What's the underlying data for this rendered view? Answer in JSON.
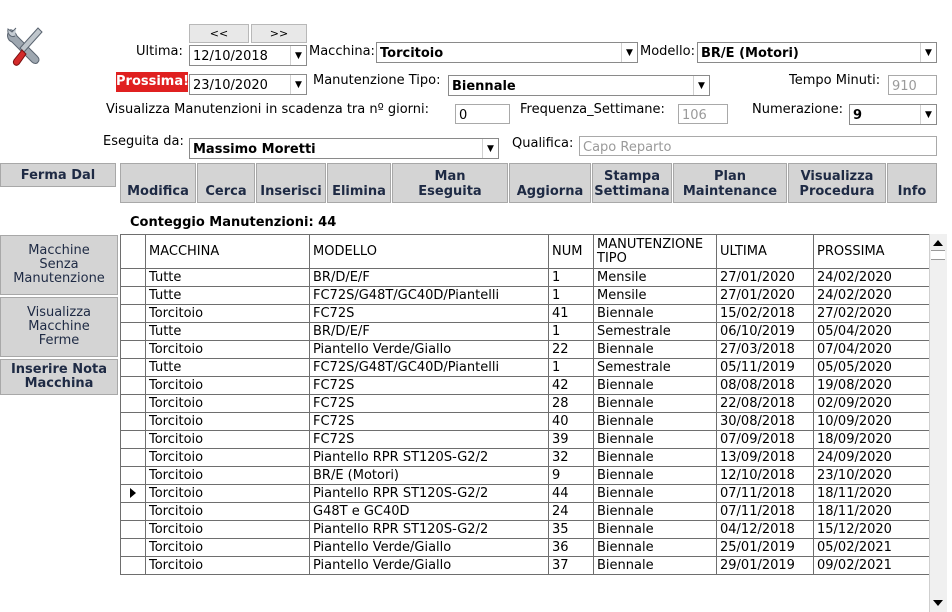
{
  "nav": {
    "prev": "<<",
    "next": ">>"
  },
  "form": {
    "ultima_label": "Ultima:",
    "ultima_value": "12/10/2018",
    "macchina_label": "Macchina:",
    "macchina_value": "Torcitoio",
    "modello_label": "Modello:",
    "modello_value": "BR/E (Motori)",
    "prossima_label": "Prossima!!",
    "prossima_value": "23/10/2020",
    "tipo_label": "Manutenzione Tipo:",
    "tipo_value": "Biennale",
    "tempo_label": "Tempo Minuti:",
    "tempo_value": "910",
    "scadenza_label": "Visualizza Manutenzioni in scadenza tra nº giorni:",
    "scadenza_value": "0",
    "frequenza_label": "Frequenza_Settimane:",
    "frequenza_value": "106",
    "numerazione_label": "Numerazione:",
    "numerazione_value": "9",
    "eseguita_label": "Eseguita da:",
    "eseguita_value": "Massimo Moretti",
    "qualifica_label": "Qualifica:",
    "qualifica_value": "Capo Reparto"
  },
  "toolbar": {
    "ferma_dal": "Ferma Dal",
    "modifica": "Modifica",
    "cerca": "Cerca",
    "inserisci": "Inserisci",
    "elimina": "Elimina",
    "man_eseguita_1": "Man",
    "man_eseguita_2": "Eseguita",
    "aggiorna": "Aggiorna",
    "stampa_1": "Stampa",
    "stampa_2": "Settimana",
    "plan_1": "Plan",
    "plan_2": "Maintenance",
    "visualizza_1": "Visualizza",
    "visualizza_2": "Procedura",
    "info": "Info"
  },
  "sidebar": {
    "senza_1": "Macchine",
    "senza_2": "Senza",
    "senza_3": "Manutenzione",
    "ferme_1": "Visualizza",
    "ferme_2": "Macchine",
    "ferme_3": "Ferme",
    "nota_1": "Inserire Nota",
    "nota_2": "Macchina"
  },
  "count_label": "Conteggio Manutenzioni: 44",
  "table": {
    "headers": [
      "MACCHINA",
      "MODELLO",
      "NUM",
      "MANUTENZIONE TIPO",
      "ULTIMA",
      "PROSSIMA"
    ],
    "selected_row": 12,
    "rows": [
      [
        "Tutte",
        "BR/D/E/F",
        "1",
        "Mensile",
        "27/01/2020",
        "24/02/2020"
      ],
      [
        "Tutte",
        "FC72S/G48T/GC40D/Piantelli",
        "1",
        "Mensile",
        "27/01/2020",
        "24/02/2020"
      ],
      [
        "Torcitoio",
        "FC72S",
        "41",
        "Biennale",
        "15/02/2018",
        "27/02/2020"
      ],
      [
        "Tutte",
        "BR/D/E/F",
        "1",
        "Semestrale",
        "06/10/2019",
        "05/04/2020"
      ],
      [
        "Torcitoio",
        "Piantello Verde/Giallo",
        "22",
        "Biennale",
        "27/03/2018",
        "07/04/2020"
      ],
      [
        "Tutte",
        "FC72S/G48T/GC40D/Piantelli",
        "1",
        "Semestrale",
        "05/11/2019",
        "05/05/2020"
      ],
      [
        "Torcitoio",
        "FC72S",
        "42",
        "Biennale",
        "08/08/2018",
        "19/08/2020"
      ],
      [
        "Torcitoio",
        "FC72S",
        "28",
        "Biennale",
        "22/08/2018",
        "02/09/2020"
      ],
      [
        "Torcitoio",
        "FC72S",
        "40",
        "Biennale",
        "30/08/2018",
        "10/09/2020"
      ],
      [
        "Torcitoio",
        "FC72S",
        "39",
        "Biennale",
        "07/09/2018",
        "18/09/2020"
      ],
      [
        "Torcitoio",
        "Piantello RPR ST120S-G2/2",
        "32",
        "Biennale",
        "13/09/2018",
        "24/09/2020"
      ],
      [
        "Torcitoio",
        "BR/E (Motori)",
        "9",
        "Biennale",
        "12/10/2018",
        "23/10/2020"
      ],
      [
        "Torcitoio",
        "Piantello RPR ST120S-G2/2",
        "44",
        "Biennale",
        "07/11/2018",
        "18/11/2020"
      ],
      [
        "Torcitoio",
        "G48T e GC40D",
        "24",
        "Biennale",
        "07/11/2018",
        "18/11/2020"
      ],
      [
        "Torcitoio",
        "Piantello RPR ST120S-G2/2",
        "35",
        "Biennale",
        "04/12/2018",
        "15/12/2020"
      ],
      [
        "Torcitoio",
        "Piantello Verde/Giallo",
        "36",
        "Biennale",
        "25/01/2019",
        "05/02/2021"
      ],
      [
        "Torcitoio",
        "Piantello Verde/Giallo",
        "37",
        "Biennale",
        "29/01/2019",
        "09/02/2021"
      ]
    ]
  }
}
